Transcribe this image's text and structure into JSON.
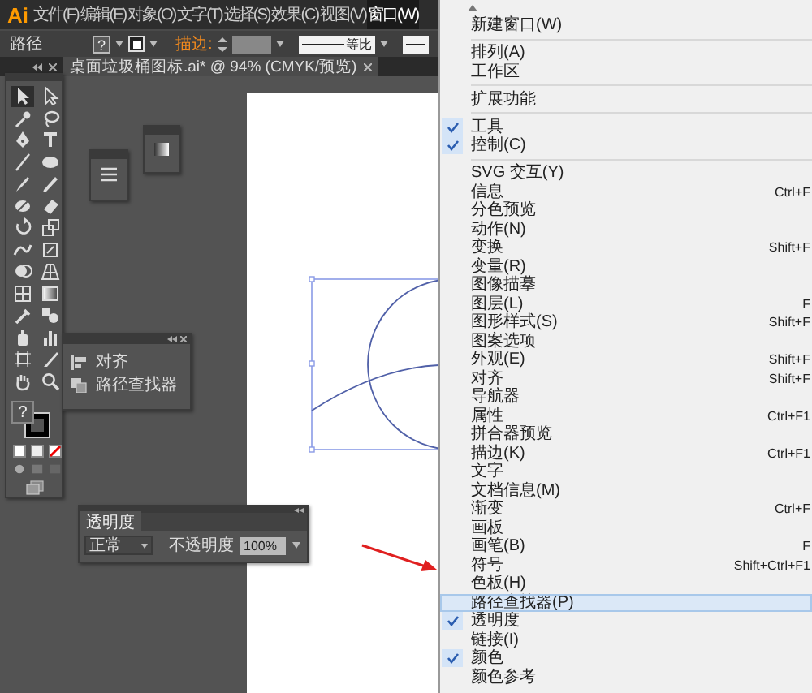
{
  "menubar": {
    "logo": "Ai",
    "items": [
      {
        "label": "文件(F)",
        "selected": false
      },
      {
        "label": "编辑(E)",
        "selected": false
      },
      {
        "label": "对象(O)",
        "selected": false
      },
      {
        "label": "文字(T)",
        "selected": false
      },
      {
        "label": "选择(S)",
        "selected": false
      },
      {
        "label": "效果(C)",
        "selected": false
      },
      {
        "label": "视图(V)",
        "selected": false
      },
      {
        "label": "窗口(W)",
        "selected": true
      }
    ]
  },
  "control_bar": {
    "label": "路径",
    "fill_button": "?",
    "stroke_label": "描边:",
    "stroke_profile": "等比"
  },
  "document_tab": {
    "title": "桌面垃圾桶图标.ai* @ 94% (CMYK/预览)"
  },
  "toolbox": {
    "fill_swatch": "?"
  },
  "align_panel": {
    "items": [
      "对齐",
      "路径查找器"
    ]
  },
  "transparency_panel": {
    "title": "透明度",
    "blend_mode": "正常",
    "opacity_label": "不透明度",
    "opacity": "100%"
  },
  "window_menu": {
    "sections": [
      [
        {
          "label": "新建窗口(W)",
          "checked": false,
          "selected": false
        }
      ],
      [
        {
          "label": "排列(A)",
          "checked": false,
          "selected": false
        },
        {
          "label": "工作区",
          "checked": false,
          "selected": false
        }
      ],
      [
        {
          "label": "扩展功能",
          "checked": false,
          "selected": false
        }
      ],
      [
        {
          "label": "工具",
          "checked": true,
          "selected": false
        },
        {
          "label": "控制(C)",
          "checked": true,
          "selected": false
        }
      ],
      [
        {
          "label": "SVG 交互(Y)",
          "checked": false,
          "selected": false
        },
        {
          "label": "信息",
          "shortcut": "Ctrl+F",
          "checked": false,
          "selected": false
        },
        {
          "label": "分色预览",
          "checked": false,
          "selected": false
        },
        {
          "label": "动作(N)",
          "checked": false,
          "selected": false
        },
        {
          "label": "变换",
          "shortcut": "Shift+F",
          "checked": false,
          "selected": false
        },
        {
          "label": "变量(R)",
          "checked": false,
          "selected": false
        },
        {
          "label": "图像描摹",
          "checked": false,
          "selected": false
        },
        {
          "label": "图层(L)",
          "shortcut": "F",
          "checked": false,
          "selected": false
        },
        {
          "label": "图形样式(S)",
          "shortcut": "Shift+F",
          "checked": false,
          "selected": false
        },
        {
          "label": "图案选项",
          "checked": false,
          "selected": false
        },
        {
          "label": "外观(E)",
          "shortcut": "Shift+F",
          "checked": false,
          "selected": false
        },
        {
          "label": "对齐",
          "shortcut": "Shift+F",
          "checked": false,
          "selected": false
        },
        {
          "label": "导航器",
          "checked": false,
          "selected": false
        },
        {
          "label": "属性",
          "shortcut": "Ctrl+F1",
          "checked": false,
          "selected": false
        },
        {
          "label": "拼合器预览",
          "checked": false,
          "selected": false
        },
        {
          "label": "描边(K)",
          "shortcut": "Ctrl+F1",
          "checked": false,
          "selected": false
        },
        {
          "label": "文字",
          "checked": false,
          "selected": false
        },
        {
          "label": "文档信息(M)",
          "checked": false,
          "selected": false
        },
        {
          "label": "渐变",
          "shortcut": "Ctrl+F",
          "checked": false,
          "selected": false
        },
        {
          "label": "画板",
          "checked": false,
          "selected": false
        },
        {
          "label": "画笔(B)",
          "shortcut": "F",
          "checked": false,
          "selected": false
        },
        {
          "label": "符号",
          "shortcut": "Shift+Ctrl+F1",
          "checked": false,
          "selected": false
        },
        {
          "label": "色板(H)",
          "checked": false,
          "selected": false
        },
        {
          "label": "路径查找器(P)",
          "checked": false,
          "selected": true
        },
        {
          "label": "透明度",
          "checked": true,
          "selected": false
        },
        {
          "label": "链接(I)",
          "checked": false,
          "selected": false
        },
        {
          "label": "颜色",
          "checked": true,
          "selected": false
        },
        {
          "label": "颜色参考",
          "checked": false,
          "selected": false
        }
      ]
    ]
  }
}
